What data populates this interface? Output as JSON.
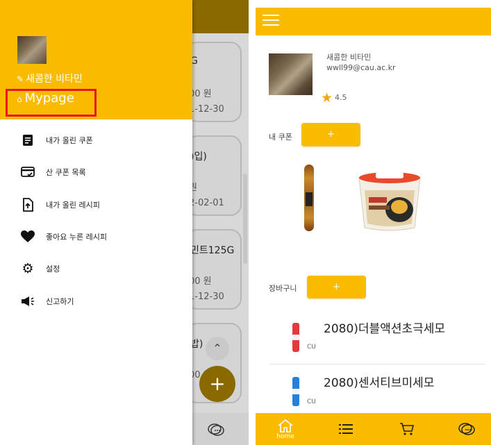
{
  "drawer": {
    "user_name": "새콤한 비타민",
    "mypage_label": "Mypage",
    "menu": [
      {
        "icon": "document-icon",
        "label": "내가 올린 쿠폰"
      },
      {
        "icon": "card-check-icon",
        "label": "산 쿠폰 목록"
      },
      {
        "icon": "file-upload-icon",
        "label": "내가 올린 레시피"
      },
      {
        "icon": "heart-icon",
        "label": "좋아요 누른 레시피"
      },
      {
        "icon": "gear-icon",
        "label": "설정"
      },
      {
        "icon": "megaphone-icon",
        "label": "신고하기"
      }
    ]
  },
  "background_page": {
    "cards": [
      {
        "line1": "G",
        "line2": "00 원",
        "line3": "1-12-30"
      },
      {
        "line1": ")입)",
        "line2": "원",
        "line3": "2-02-01"
      },
      {
        "line1": "민트125G",
        "line2": "00 원",
        "line3": "1-12-30"
      },
      {
        "line1": "밥)",
        "line2": "00 원",
        "line3": ""
      }
    ]
  },
  "mypage": {
    "profile": {
      "name": "새콤한 비타민",
      "email": "wwll99@cau.ac.kr",
      "rating": "4.5"
    },
    "my_coupons_label": "내 쿠폰",
    "add_button_label": "+",
    "cart_label": "장바구니",
    "cart_items": [
      {
        "name": "2080)더블액션초극세모",
        "store": "CU"
      },
      {
        "name": "2080)센서티브미세모",
        "store": "CU"
      }
    ],
    "nav": [
      {
        "icon": "home-icon",
        "label": "home"
      },
      {
        "icon": "list-icon",
        "label": ""
      },
      {
        "icon": "cart-icon",
        "label": ""
      },
      {
        "icon": "chat-icon",
        "label": ""
      }
    ]
  },
  "colors": {
    "accent": "#fbbc00",
    "highlight_box": "#e8141f",
    "star": "#f6a800"
  }
}
